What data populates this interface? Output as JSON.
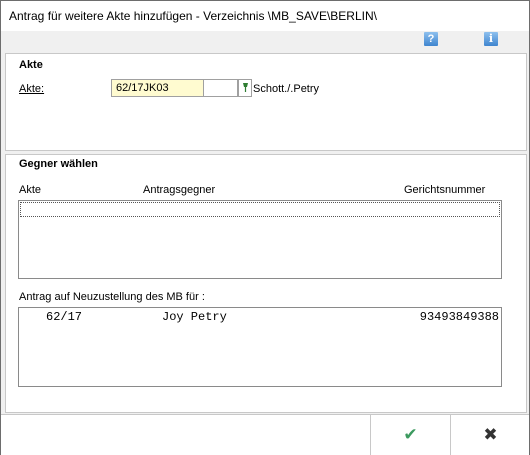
{
  "window": {
    "title": "Antrag für weitere Akte hinzufügen - Verzeichnis \\MB_SAVE\\BERLIN\\"
  },
  "toolbar": {
    "help_glyph": "?",
    "info_glyph": "i"
  },
  "akte_section": {
    "title": "Akte",
    "akte_label": "Akte:",
    "akte_value": "62/17JK03",
    "akte_suffix_value": "",
    "party_text": "Schott./.Petry"
  },
  "gegner_section": {
    "title": "Gegner wählen",
    "columns": [
      "Akte",
      "Antragsgegner",
      "Gerichtsnummer"
    ],
    "rows": [],
    "neuzustellung_label": "Antrag auf Neuzustellung des MB für :",
    "neuzustellung_rows": [
      {
        "akte": "62/17",
        "name": "Joy Petry",
        "gerichtsnummer": "93493849388"
      }
    ]
  },
  "footer": {
    "ok_glyph": "✔",
    "cancel_glyph": "✖"
  },
  "colors": {
    "accent": "#3f85cf",
    "ok_green": "#3c9a5f",
    "highlight_field": "#fffbd0",
    "cancel_dark": "#333333"
  }
}
